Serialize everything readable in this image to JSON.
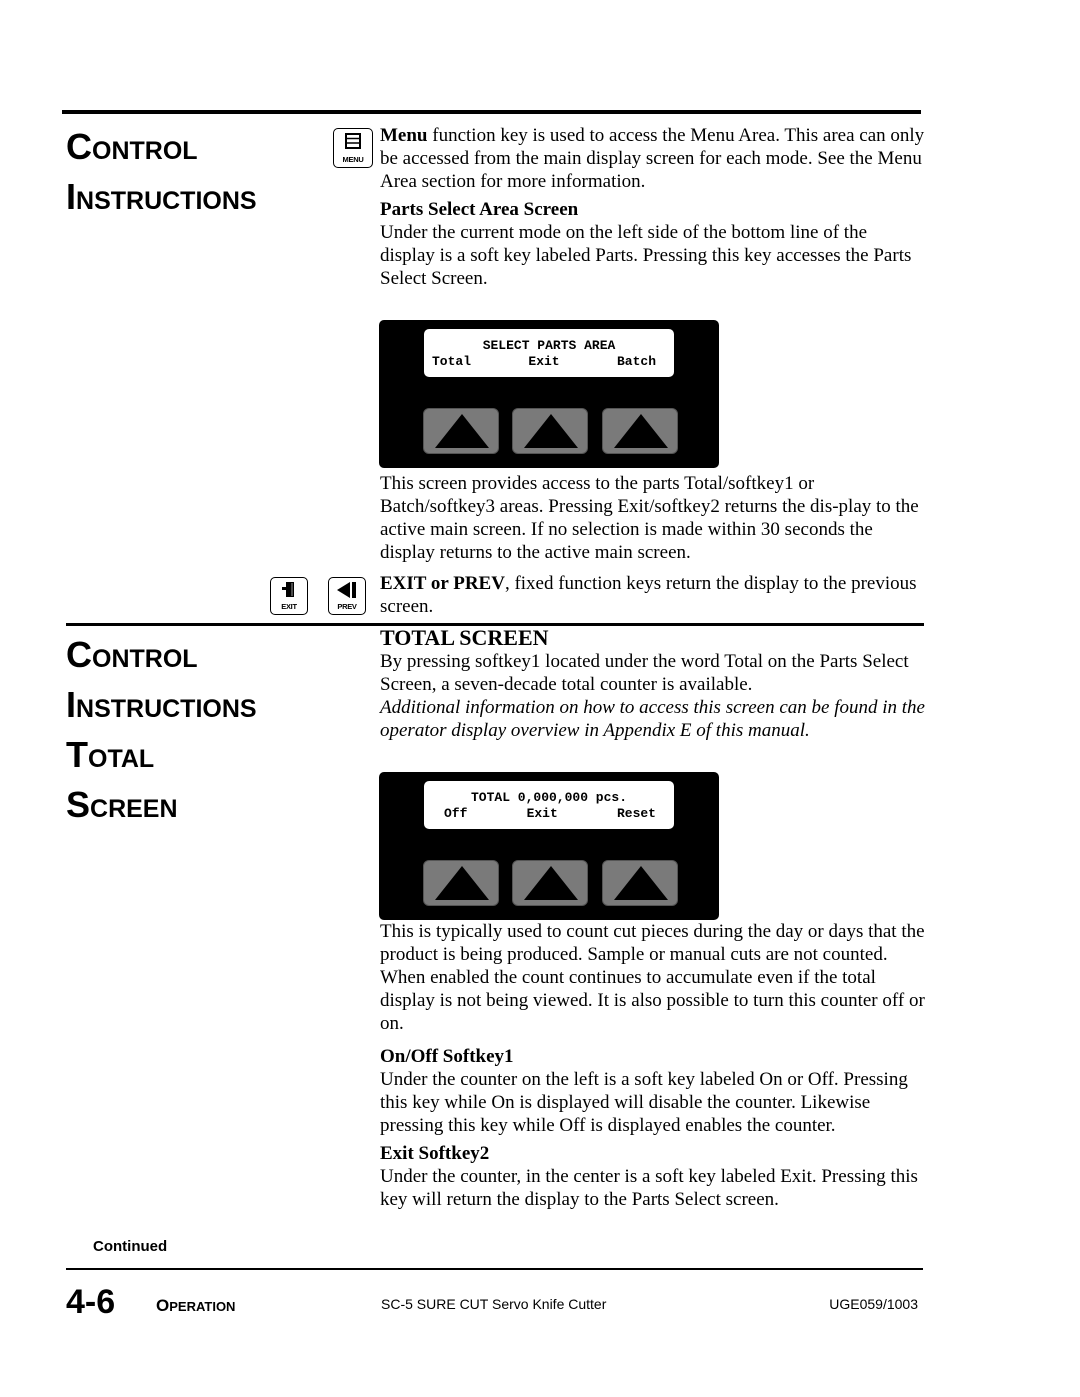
{
  "section1": {
    "title_line1": {
      "cap": "C",
      "rest": "ONTROL"
    },
    "title_line2": {
      "cap": "I",
      "rest": "NSTRUCTIONS"
    },
    "menu_key": {
      "icon": "menu-icon",
      "label": "MENU"
    },
    "menu_intro_bold": "Menu",
    "menu_intro_text": " function key is used to access the Menu Area. This area can only be accessed from the main display screen for each mode. See the Menu Area section for  more information.",
    "parts_select_heading": "Parts Select Area Screen",
    "parts_select_text": "Under the current mode on the left side of the bottom line of the display is a soft key labeled Parts. Pressing this key accesses the Parts Select Screen.",
    "display": {
      "line1": "SELECT PARTS AREA",
      "softkeys": [
        "Total",
        "Exit",
        "Batch"
      ]
    },
    "screen_desc": "This screen provides access to the parts Total/softkey1 or Batch/softkey3 areas. Pressing Exit/softkey2 returns the dis-play to the active main screen. If no selection is made within 30 seconds the display returns to the active main screen.",
    "exit_prev_bold": "EXIT or PREV",
    "exit_prev_text": ", fixed function keys return the display to the previous screen.",
    "exit_key": {
      "icon": "exit-door-icon",
      "label": "EXIT"
    },
    "prev_key": {
      "icon": "prev-arrow-icon",
      "label": "PREV"
    }
  },
  "section2": {
    "title_line1": {
      "cap": "C",
      "rest": "ONTROL"
    },
    "title_line2": {
      "cap": "I",
      "rest": "NSTRUCTIONS"
    },
    "title_line3": {
      "cap": "T",
      "rest": "OTAL"
    },
    "title_line4": {
      "cap": "S",
      "rest": "CREEN"
    },
    "heading": "TOTAL SCREEN",
    "intro": "By pressing softkey1 located under the word Total on the Parts Select Screen, a seven-decade total counter is available.",
    "intro_italic": "Additional information on how to access this screen can be found in the operator display overview in Appendix E of this manual.",
    "display": {
      "line1": "TOTAL 0,000,000 pcs.",
      "softkeys": [
        "Off",
        "Exit",
        "Reset"
      ]
    },
    "usage_text": "This is typically used to count cut pieces during the day or days that the product is being produced. Sample or manual cuts are not counted. When enabled the count continues to accumulate even if the total display is not being viewed. It is also possible to turn this counter off or on.",
    "onoff_heading": "On/Off Softkey1",
    "onoff_text": "Under the counter on the left is a soft key labeled On or Off. Pressing this key while On is displayed will disable the counter. Likewise pressing this key while Off is displayed enables the counter.",
    "exit_heading": "Exit Softkey2",
    "exit_text": "Under the counter, in the center is a soft key labeled Exit. Pressing this key will return the display to the Parts Select screen."
  },
  "footer": {
    "continued": "Continued",
    "page_number": "4-6",
    "section_cap": "O",
    "section_rest": "PERATION",
    "doc_title": "SC-5 SURE CUT Servo Knife Cutter",
    "doc_code": "UGE059/1003"
  }
}
